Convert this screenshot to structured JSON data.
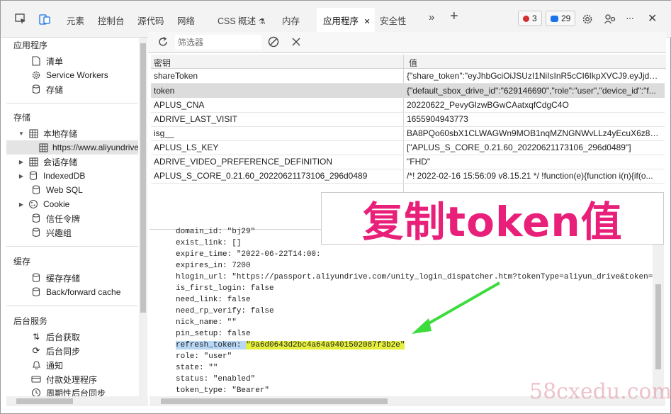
{
  "toolbar": {
    "tabs": [
      "元素",
      "控制台",
      "源代码",
      "网络",
      "CSS 概述",
      "内存",
      "应用程序",
      "安全性"
    ],
    "errors_count": "3",
    "messages_count": "29",
    "more_tabs": "»",
    "add_tab": "+",
    "more_options": "···",
    "close": "✕"
  },
  "sidebar": {
    "app_title": "应用程序",
    "app_items": [
      "清单",
      "Service Workers",
      "存储"
    ],
    "storage_title": "存储",
    "local_storage": "本地存储",
    "local_storage_child": "https://www.aliyundrive.com",
    "session_storage": "会话存储",
    "indexeddb": "IndexedDB",
    "websql": "Web SQL",
    "cookie": "Cookie",
    "trust_tokens": "信任令牌",
    "interest_groups": "兴趣组",
    "cache_title": "缓存",
    "cache_storage": "缓存存储",
    "bfcache": "Back/forward cache",
    "bg_title": "后台服务",
    "bg_fetch": "后台获取",
    "bg_sync": "后台同步",
    "notifications": "通知",
    "payment_handler": "付款处理程序",
    "periodic_sync": "周期性后台同步"
  },
  "filter": {
    "placeholder": "筛选器"
  },
  "table": {
    "col_key": "密钥",
    "col_value": "值",
    "rows": [
      {
        "key": "shareToken",
        "value": "{\"share_token\":\"eyJhbGciOiJSUzI1NiIsInR5cCI6IkpXVCJ9.eyJjdXN..."
      },
      {
        "key": "token",
        "value": "{\"default_sbox_drive_id\":\"629146690\",\"role\":\"user\",\"device_id\":\"f..."
      },
      {
        "key": "APLUS_CNA",
        "value": "20220622_PevyGlzwBGwCAatxqfCdgC4O"
      },
      {
        "key": "ADRIVE_LAST_VISIT",
        "value": "1655904943773"
      },
      {
        "key": "isg__",
        "value": "BA8PQo60sbX1CLWAGWn9MOB1nqMZNGNWvLLz4yEcuX6z8C..."
      },
      {
        "key": "APLUS_LS_KEY",
        "value": "[\"APLUS_S_CORE_0.21.60_20220621173106_296d0489\"]"
      },
      {
        "key": "ADRIVE_VIDEO_PREFERENCE_DEFINITION",
        "value": "\"FHD\""
      },
      {
        "key": "APLUS_S_CORE_0.21.60_20220621173106_296d0489",
        "value": "/*! 2022-02-16 15:56:09 v8.15.21 */ !function(e){function i(n){if(o..."
      }
    ]
  },
  "json_view": {
    "l0": "domain_id: \"bj29\"",
    "l1": "exist_link: []",
    "l2": "expire_time: \"2022-06-22T14:00:",
    "l3": "expires_in: 7200",
    "l4": "hlogin_url: \"https://passport.aliyundrive.com/unity_login_dispatcher.htm?tokenType=aliyun_drive&token=",
    "l5": "is_first_login: false",
    "l6": "need_link: false",
    "l7": "need_rp_verify: false",
    "l8": "nick_name: \"\"",
    "l9": "pin_setup: false",
    "refresh_key": "refresh_token: ",
    "refresh_value": "\"9a6d0643d2bc4a64a9401502087f3b2e\"",
    "l11": "role: \"user\"",
    "l12": "state: \"\"",
    "l13": "status: \"enabled\"",
    "l14": "token_type: \"Bearer\""
  },
  "annotation": {
    "text": "复制token值",
    "color": "#e8207a",
    "arrow_color": "#3ddc3d"
  },
  "watermark": "58cxedu.com",
  "colors": {
    "accent": "#1a73e8",
    "error": "#d32f2f"
  }
}
